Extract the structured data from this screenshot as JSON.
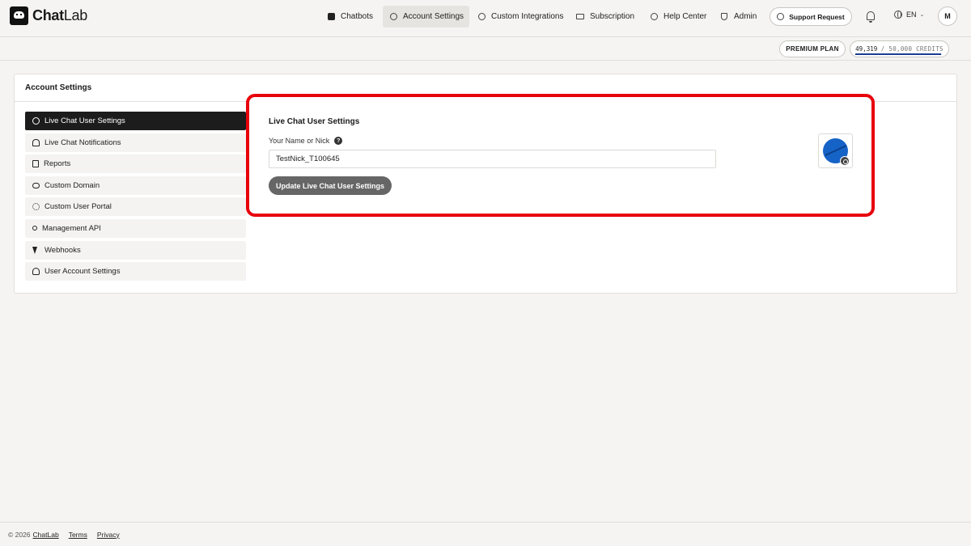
{
  "app": {
    "name_bold": "Chat",
    "name_regular": "Lab"
  },
  "nav": {
    "items": [
      {
        "label": "Chatbots",
        "icon": "chatbot-icon"
      },
      {
        "label": "Account Settings",
        "icon": "gear-icon",
        "active": true
      },
      {
        "label": "Custom Integrations",
        "icon": "integrations-icon"
      },
      {
        "label": "Subscription",
        "icon": "card-icon"
      },
      {
        "label": "Help Center",
        "icon": "help-icon"
      },
      {
        "label": "Admin",
        "icon": "shield-icon"
      }
    ],
    "support_label": "Support Request",
    "language": "EN",
    "user_initial": "M"
  },
  "plan": {
    "label": "PREMIUM PLAN",
    "credits_used": "49,319",
    "credits_total": "/ 50,000 CREDITS",
    "credits_fraction": 0.986
  },
  "settings": {
    "title": "Account Settings",
    "sidebar": [
      {
        "label": "Live Chat User Settings",
        "icon": "user-circle-icon",
        "active": true
      },
      {
        "label": "Live Chat Notifications",
        "icon": "bell-icon"
      },
      {
        "label": "Reports",
        "icon": "document-icon"
      },
      {
        "label": "Custom Domain",
        "icon": "cloud-icon"
      },
      {
        "label": "Custom User Portal",
        "icon": "gear-icon"
      },
      {
        "label": "Management API",
        "icon": "key-icon"
      },
      {
        "label": "Webhooks",
        "icon": "bolt-icon"
      },
      {
        "label": "User Account Settings",
        "icon": "user-icon"
      }
    ]
  },
  "card": {
    "title": "Live Chat User Settings",
    "field_label": "Your Name or Nick",
    "help_glyph": "?",
    "name_value": "TestNick_T100645",
    "button_label": "Update Live Chat User Settings",
    "highlight_color": "#e8000b"
  },
  "footer": {
    "copyright": "© 2026",
    "brand": "ChatLab",
    "terms": "Terms",
    "privacy": "Privacy"
  }
}
